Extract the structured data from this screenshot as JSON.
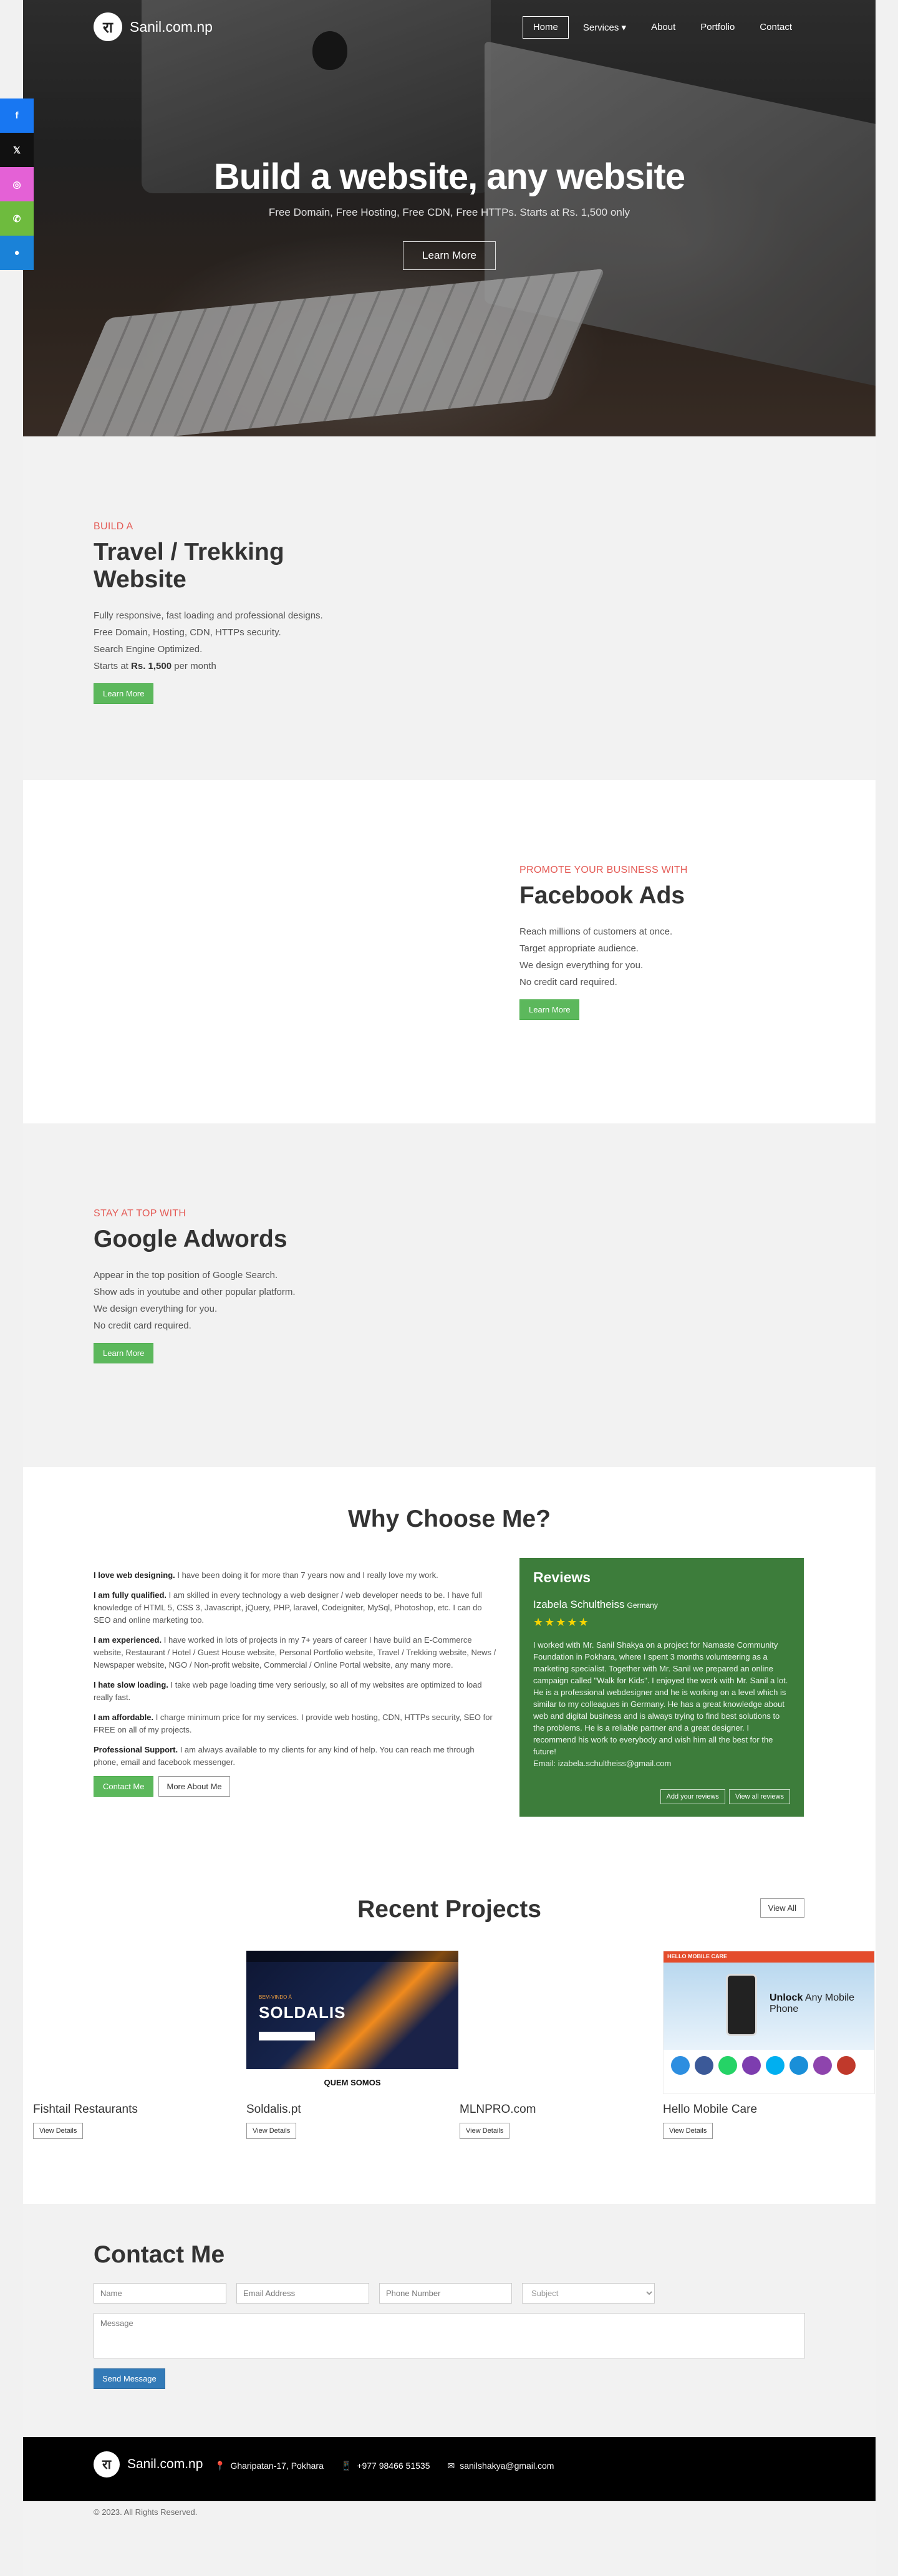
{
  "social": [
    {
      "name": "facebook-icon",
      "glyph": "f"
    },
    {
      "name": "x-icon",
      "glyph": "𝕏"
    },
    {
      "name": "instagram-icon",
      "glyph": "◎"
    },
    {
      "name": "whatsapp-icon",
      "glyph": "✆"
    },
    {
      "name": "messenger-icon",
      "glyph": "●"
    }
  ],
  "brand": {
    "logo": "रा",
    "name": "Sanil.com.np"
  },
  "nav": [
    "Home",
    "Services ▾",
    "About",
    "Portfolio",
    "Contact"
  ],
  "hero": {
    "title": "Build a website, any website",
    "subtitle": "Free Domain, Free Hosting, Free CDN, Free HTTPs. Starts at Rs. 1,500 only",
    "button": "Learn More"
  },
  "features": [
    {
      "kicker": "BUILD A",
      "title": "Travel / Trekking Website",
      "lines": [
        "Fully responsive, fast loading and professional designs.",
        "Free Domain, Hosting, CDN, HTTPs security.",
        "Search Engine Optimized."
      ],
      "price_prefix": "Starts at ",
      "price": "Rs. 1,500",
      "price_suffix": " per month",
      "button": "Learn More"
    },
    {
      "kicker": "PROMOTE YOUR BUSINESS WITH",
      "title": "Facebook Ads",
      "lines": [
        "Reach millions of customers at once.",
        "Target appropriate audience.",
        "We design everything for you.",
        "No credit card required."
      ],
      "button": "Learn More"
    },
    {
      "kicker": "STAY AT TOP WITH",
      "title": "Google Adwords",
      "lines": [
        "Appear in the top position of Google Search.",
        "Show ads in youtube and other popular platform.",
        "We design everything for you.",
        "No credit card required."
      ],
      "button": "Learn More"
    }
  ],
  "why": {
    "title": "Why Choose Me?",
    "points": [
      {
        "head": "I love web designing.",
        "text": " I have been doing it for more than 7 years now and I really love my work."
      },
      {
        "head": "I am fully qualified.",
        "text": " I am skilled in every technology a web designer / web developer needs to be. I have full knowledge of HTML 5, CSS 3, Javascript, jQuery, PHP, laravel, Codeigniter, MySql, Photoshop, etc. I can do SEO and online marketing too."
      },
      {
        "head": "I am experienced.",
        "text": " I have worked in lots of projects in my 7+ years of career I have build an E-Commerce website, Restaurant / Hotel / Guest House website, Personal Portfolio website, Travel / Trekking website, News / Newspaper website, NGO / Non-profit website, Commercial / Online Portal website, any many more."
      },
      {
        "head": "I hate slow loading.",
        "text": " I take web page loading time very seriously, so all of my websites are optimized to load really fast."
      },
      {
        "head": "I am affordable.",
        "text": " I charge minimum price for my services. I provide web hosting, CDN, HTTPs security, SEO for FREE on all of my projects."
      },
      {
        "head": "Professional Support.",
        "text": " I am always available to my clients for any kind of help. You can reach me through phone, email and facebook messenger."
      }
    ],
    "contact_button": "Contact Me",
    "about_button": "More About Me"
  },
  "review": {
    "title": "Reviews",
    "name": "Izabela Schultheiss",
    "country": "Germany",
    "stars": "★★★★★",
    "text": "I worked with Mr. Sanil Shakya on a project for Namaste Community Foundation in Pokhara, where I spent 3 months volunteering as a marketing specialist. Together with Mr. Sanil we prepared an online campaign called \"Walk for Kids\". I enjoyed the work with Mr. Sanil a lot. He is a professional webdesigner and he is working on a level which is similar to my colleagues in Germany. He has a great knowledge about web and digital business and is always trying to find best solutions to the problems. He is a reliable partner and a great designer. I recommend his work to everybody and wish him all the best for the future!",
    "email": "Email: izabela.schultheiss@gmail.com",
    "add_button": "Add your reviews",
    "all_button": "View all reviews"
  },
  "projects": {
    "title": "Recent Projects",
    "view_all": "View All",
    "items": [
      {
        "name": "Fishtail Restaurants",
        "button": "View Details"
      },
      {
        "name": "Soldalis.pt",
        "button": "View Details",
        "shot_welcome": "BEM-VINDO À",
        "shot_logo": "SOLDALIS",
        "shot_footer": "QUEM SOMOS"
      },
      {
        "name": "MLNPRO.com",
        "button": "View Details"
      },
      {
        "name": "Hello Mobile Care",
        "button": "View Details",
        "shot_bar": "HELLO MOBILE CARE",
        "shot_strong": "Unlock",
        "shot_text": " Any Mobile Phone"
      }
    ]
  },
  "contact": {
    "title": "Contact Me",
    "name_placeholder": "Name",
    "email_placeholder": "Email Address",
    "phone_placeholder": "Phone Number",
    "subject": "Subject",
    "message_placeholder": "Message",
    "send": "Send Message"
  },
  "footer": {
    "address": "Gharipatan-17, Pokhara",
    "phone": "+977 98466 51535",
    "email": "sanilshakya@gmail.com",
    "copyright": "© 2023. All Rights Reserved."
  },
  "colors": {
    "accent_green": "#5cb85c",
    "review_green": "#3d7d3b",
    "kicker_red": "#e45a55",
    "send_blue": "#337ab7"
  }
}
